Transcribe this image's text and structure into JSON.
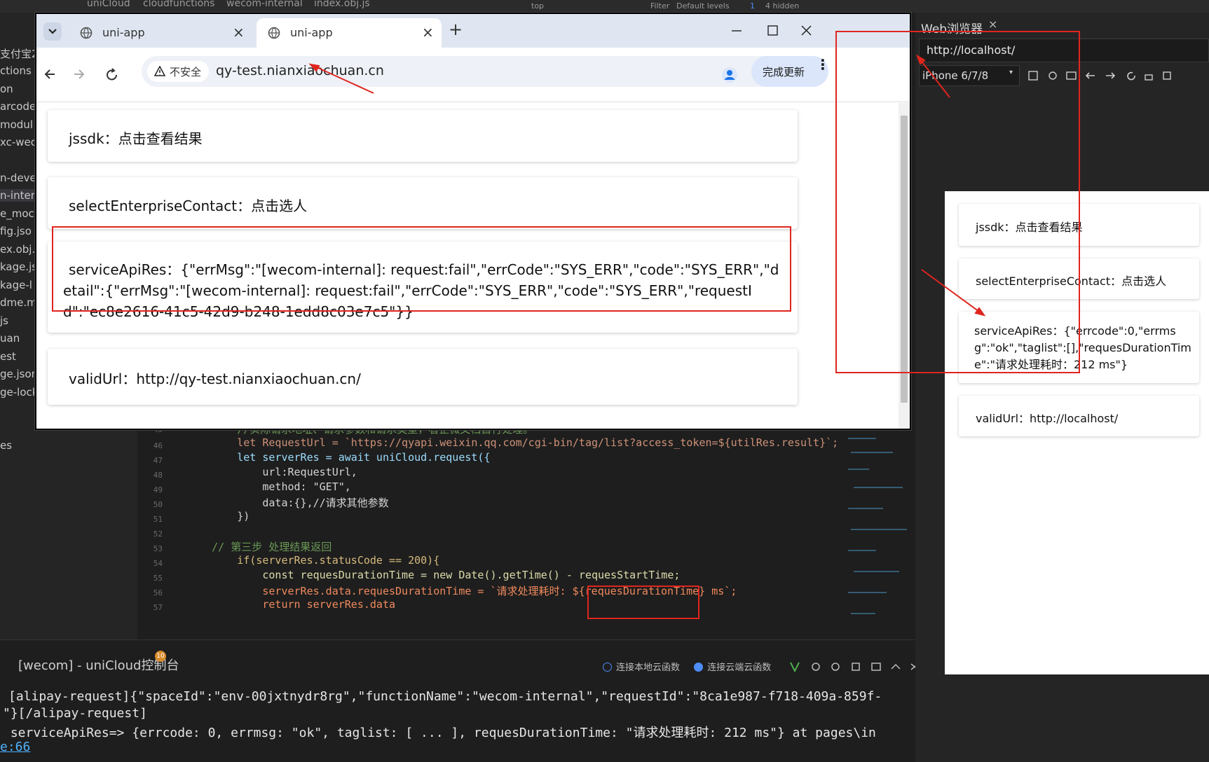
{
  "ide": {
    "breadcrumb": [
      "uniCloud",
      "cloudfunctions",
      "wecom-internal",
      "index.obj.js"
    ],
    "devtools_bar": {
      "top_select": "top",
      "filter": "Filter",
      "levels": "Default levels",
      "issues_count": "1",
      "hidden": "4 hidden"
    },
    "explorer_items": [
      {
        "text": "支付宝2",
        "selected": false
      },
      {
        "text": "ctions",
        "selected": false
      },
      {
        "text": "on",
        "selected": false
      },
      {
        "text": "arcode",
        "selected": false
      },
      {
        "text": "modul",
        "selected": false
      },
      {
        "text": "xc-wec",
        "selected": false
      },
      {
        "text": "n-deve",
        "selected": false
      },
      {
        "text": "n-inter",
        "selected": true
      },
      {
        "text": "e_moc",
        "selected": false
      },
      {
        "text": "fig.jso",
        "selected": false
      },
      {
        "text": "ex.obj.",
        "selected": false
      },
      {
        "text": "kage.js",
        "selected": false
      },
      {
        "text": "kage-l",
        "selected": false
      },
      {
        "text": "dme.m",
        "selected": false
      },
      {
        "text": "js",
        "selected": false
      },
      {
        "text": "uan",
        "selected": false
      },
      {
        "text": "est",
        "selected": false
      },
      {
        "text": "ge.json",
        "selected": false
      },
      {
        "text": "ge-lock.json",
        "selected": false
      },
      {
        "text": "es",
        "selected": false
      }
    ],
    "code_lines": [
      {
        "n": "45",
        "text": "        //实际请求地址、请求参数和请求类型，看企微文档自行处理。"
      },
      {
        "n": "46",
        "text": "        let RequestUrl = `https://qyapi.weixin.qq.com/cgi-bin/tag/list?access_token=${utilRes.result}`;"
      },
      {
        "n": "47",
        "text": "        let serverRes = await uniCloud.request({"
      },
      {
        "n": "48",
        "text": "            url:RequestUrl,"
      },
      {
        "n": "49",
        "text": "            method: \"GET\","
      },
      {
        "n": "50",
        "text": "            data:{},//请求其他参数"
      },
      {
        "n": "51",
        "text": "        })"
      },
      {
        "n": "52",
        "text": ""
      },
      {
        "n": "53",
        "text": "    // 第三步 处理结果返回"
      },
      {
        "n": "54",
        "text": "        if(serverRes.statusCode == 200){"
      },
      {
        "n": "55",
        "text": "            const requesDurationTime = new Date().getTime() - requesStartTime;"
      },
      {
        "n": "56",
        "text": "            serverRes.data.requesDurationTime = `请求处理耗时: ${requesDurationTime} ms`;"
      },
      {
        "n": "57",
        "text": "            return serverRes.data"
      }
    ],
    "console": {
      "title": "[wecom] - uniCloud控制台",
      "badge": "10",
      "radio_local": "连接本地云函数",
      "radio_cloud": "连接云端云函数",
      "lines": [
        "[alipay-request]{\"spaceId\":\"env-00jxtnydr8rg\",\"functionName\":\"wecom-internal\",\"requestId\":\"8ca1e987-f718-409a-859f-",
        "\"}[/alipay-request]",
        " serviceApiRes=> {errcode: 0, errmsg: \"ok\", taglist: [ ... ], requesDurationTime: \"请求处理耗时: 212 ms\"} at pages\\in",
        "e:66"
      ]
    }
  },
  "browser": {
    "tabs": [
      {
        "title": "uni-app",
        "active": false
      },
      {
        "title": "uni-app",
        "active": true
      }
    ],
    "security_chip": "不安全",
    "url": "qy-test.nianxiaochuan.cn",
    "update_button": "完成更新",
    "cards": [
      {
        "label": "jssdk：点击查看结果"
      },
      {
        "label": "selectEnterpriseContact：点击选人"
      },
      {
        "label": "serviceApiRes：{\"errMsg\":\"[wecom-internal]: request:fail\",\"errCode\":\"SYS_ERR\",\"code\":\"SYS_ERR\",\"detail\":{\"errMsg\":\"[wecom-internal]: request:fail\",\"errCode\":\"SYS_ERR\",\"code\":\"SYS_ERR\",\"requestId\":\"ec8e2616-41c5-42d9-b248-1edd8c03e7c5\"}}"
      },
      {
        "label": "validUrl：http://qy-test.nianxiaochuan.cn/"
      }
    ]
  },
  "preview": {
    "tab_title": "Web浏览器",
    "address": "http://localhost/",
    "device": "iPhone 6/7/8",
    "cards": [
      {
        "label": "jssdk：点击查看结果"
      },
      {
        "label": "selectEnterpriseContact：点击选人"
      },
      {
        "label": "serviceApiRes：{\"errcode\":0,\"errmsg\":\"ok\",\"taglist\":[],\"requesDurationTime\":\"请求处理耗时：212 ms\"}"
      },
      {
        "label": "validUrl：http://localhost/"
      }
    ]
  },
  "colors": {
    "annotation_red": "#e0251e",
    "accent_blue": "#4c8df6"
  }
}
